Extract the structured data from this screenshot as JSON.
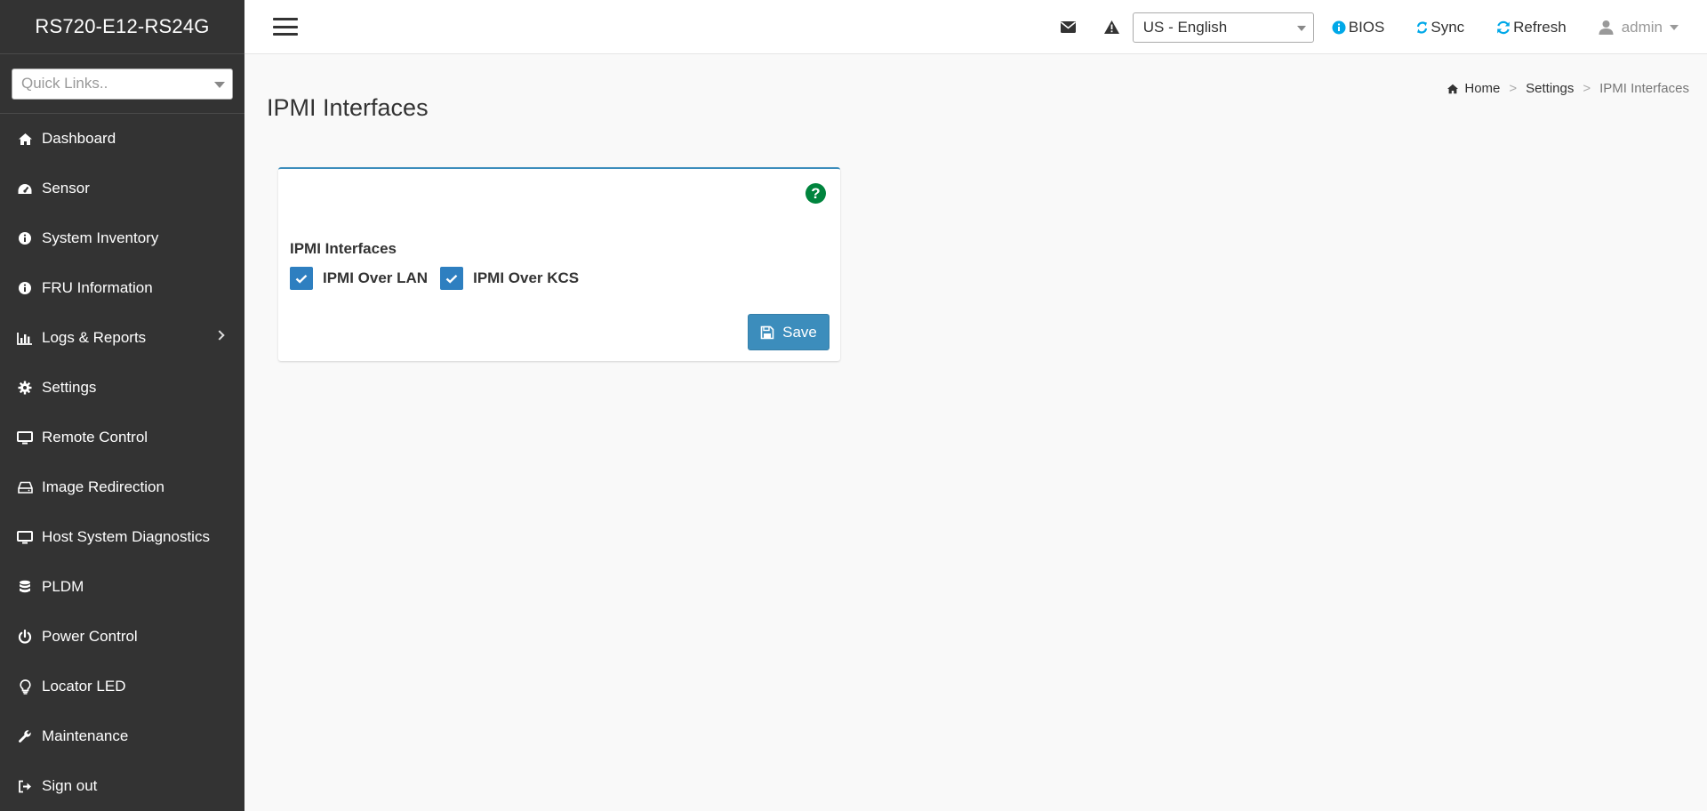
{
  "sidebar": {
    "brand": "RS720-E12-RS24G",
    "quick_links_placeholder": "Quick Links..",
    "items": [
      {
        "label": "Dashboard",
        "icon": "home-icon"
      },
      {
        "label": "Sensor",
        "icon": "dashboard-gauge-icon"
      },
      {
        "label": "System Inventory",
        "icon": "info-icon"
      },
      {
        "label": "FRU Information",
        "icon": "info-icon"
      },
      {
        "label": "Logs & Reports",
        "icon": "bar-chart-icon",
        "has_submenu": true
      },
      {
        "label": "Settings",
        "icon": "gear-icon"
      },
      {
        "label": "Remote Control",
        "icon": "monitor-icon"
      },
      {
        "label": "Image Redirection",
        "icon": "hdd-icon"
      },
      {
        "label": "Host System Diagnostics",
        "icon": "monitor-icon"
      },
      {
        "label": "PLDM",
        "icon": "database-icon"
      },
      {
        "label": "Power Control",
        "icon": "power-icon"
      },
      {
        "label": "Locator LED",
        "icon": "lightbulb-icon"
      },
      {
        "label": "Maintenance",
        "icon": "wrench-icon"
      },
      {
        "label": "Sign out",
        "icon": "sign-out-icon"
      }
    ]
  },
  "topbar": {
    "language": "US - English",
    "bios_label": "BIOS",
    "sync_label": "Sync",
    "refresh_label": "Refresh",
    "user_label": "admin"
  },
  "page": {
    "title": "IPMI Interfaces",
    "breadcrumb": [
      "Home",
      "Settings",
      "IPMI Interfaces"
    ]
  },
  "card": {
    "section_label": "IPMI Interfaces",
    "checkboxes": [
      {
        "label": "IPMI Over LAN",
        "checked": true
      },
      {
        "label": "IPMI Over KCS",
        "checked": true
      }
    ],
    "save_label": "Save",
    "help_glyph": "?"
  },
  "colors": {
    "sidebar_bg": "#333333",
    "accent": "#3c8dbc",
    "checkbox": "#2e7fc0",
    "help": "#00843d",
    "info": "#00a8e8"
  }
}
